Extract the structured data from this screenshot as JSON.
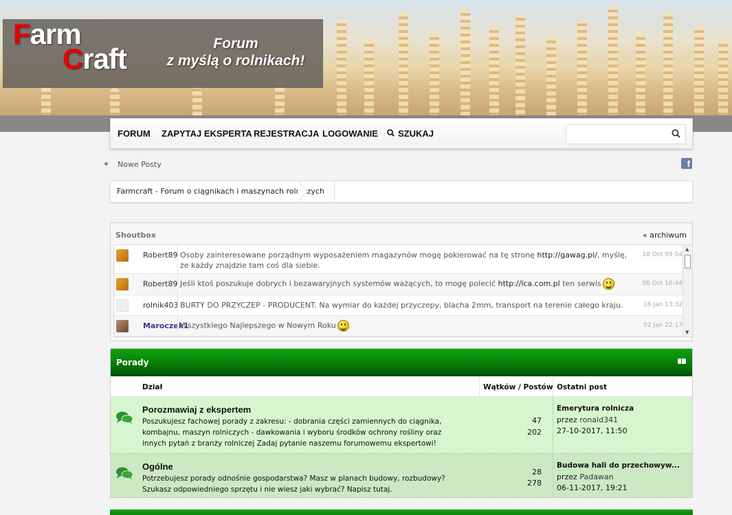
{
  "brand": {
    "logo_line1_cap": "F",
    "logo_line1_rest": "arm",
    "logo_line2_cap": "C",
    "logo_line2_rest": "raft",
    "tagline_line1": "Forum",
    "tagline_line2": "z myślą o rolnikach!",
    "accent_color": "#e60000"
  },
  "nav": {
    "items": [
      "FORUM",
      "ZAPYTAJ EKSPERTA",
      "REJESTRACJA",
      "LOGOWANIE",
      "SZUKAJ"
    ],
    "search_icon": "search-icon",
    "search_placeholder": ""
  },
  "subnav": {
    "new_posts": "Nowe Posty",
    "social_icon": "facebook-icon",
    "facebook_glyph": "f"
  },
  "breadcrumb": {
    "current": "Farmcraft - Forum o ciągnikach i maszynach rolniczych"
  },
  "shoutbox": {
    "title": "Shoutbox",
    "archive_link": "« archiwum",
    "messages": [
      {
        "user": "Robert89",
        "text_before": "Osoby zainteresowane porządnym wyposażeniem magazynów mogę pokierować na tę stronę ",
        "link": "http://gawag.pl/",
        "text_after": ", myślę, że każdy znajdzie tam coś dla siebie.",
        "date": "18 Oct 09:54",
        "smiley": false
      },
      {
        "user": "Robert89",
        "text_before": "Jeśli ktoś poszukuje dobrych i bezawaryjnych systemów ważących, to mogę polecić ",
        "link": "http://lca.com.pl",
        "text_after": " ten serwis",
        "date": "06 Oct 16:44",
        "smiley": true
      },
      {
        "user": "rolnik403",
        "text_before": "BURTY DO PRZYCZEP - PRODUCENT. Na wymiar do każdej przyczepy, blacha 2mm, transport na terenie całego kraju.",
        "link": "",
        "text_after": "",
        "date": "16 Jan 13:32",
        "smiley": false
      },
      {
        "user": "Maroczek1",
        "text_before": "Wszystkiego Najlepszego w Nowym Roku",
        "link": "",
        "text_after": "",
        "date": "02 Jan 22:17",
        "smiley": true
      }
    ]
  },
  "category": {
    "title": "Porady",
    "header_color": "#077c07",
    "columns": {
      "forum": "Dział",
      "counts": "Wątków / Postów",
      "last_post": "Ostatni post"
    },
    "forums": [
      {
        "name": "Porozmawiaj z ekspertem",
        "description": "Poszukujesz fachowej porady z zakresu: - dobrania części zamiennych do ciągnika, kombajnu, maszyn rolniczych - dawkowania i wyboru środków ochrony rośliny oraz innych pytań z branży rolniczej Zadaj pytanie naszemu forumowemu ekspertowi!",
        "threads": "47",
        "posts": "202",
        "last_title": "Emerytura rolnicza",
        "last_by_prefix": "przez ",
        "last_user": "ronald341",
        "last_date": "27-10-2017, 11:50"
      },
      {
        "name": "Ogólne",
        "description": "Potrzebujesz porady odnośnie gospodarstwa? Masz w planach budowy, rozbudowy? Szukasz odpowiedniego sprzętu i nie wiesz jaki wybrać? Napisz tutaj.",
        "threads": "28",
        "posts": "278",
        "last_title": "Budowa hali do przechowyw...",
        "last_by_prefix": "przez ",
        "last_user": "Padawan",
        "last_date": "06-11-2017, 19:21"
      }
    ]
  }
}
